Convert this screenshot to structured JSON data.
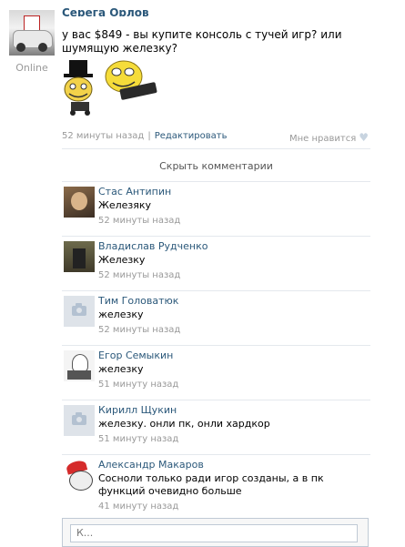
{
  "post": {
    "author": "Серега Орлов",
    "status": "Online",
    "text": "у вас $849 - вы купите консоль с тучей игр? или шумящую железку?",
    "time": "52 минуты назад",
    "separator": "|",
    "edit_label": "Редактировать",
    "like_label": "Мне нравится",
    "hide_comments_label": "Скрыть комментарии"
  },
  "comments": [
    {
      "name": "Стас Антипин",
      "text": "Железяку",
      "time": "52 минуты назад"
    },
    {
      "name": "Владислав Рудченко",
      "text": "Железку",
      "time": "52 минуты назад"
    },
    {
      "name": "Тим Головатюк",
      "text": "железку",
      "time": "52 минуты назад"
    },
    {
      "name": "Егор Семыкин",
      "text": "железку",
      "time": "51 минуту назад"
    },
    {
      "name": "Кирилл Щукин",
      "text": "железку. онли пк, онли хардкор",
      "time": "51 минуту назад"
    },
    {
      "name": "Александр Макаров",
      "text": "Сосноли только ради игор созданы, а в пк функций очевидно больше",
      "time": "41 минуту назад"
    }
  ],
  "reply": {
    "placeholder": "К..."
  },
  "colors": {
    "link": "#2b587a",
    "meta": "#999999",
    "divider": "#e4e8ed",
    "camera": "#b3c1d1"
  },
  "icons": {
    "like": "heart-icon",
    "no_photo": "camera-icon"
  }
}
